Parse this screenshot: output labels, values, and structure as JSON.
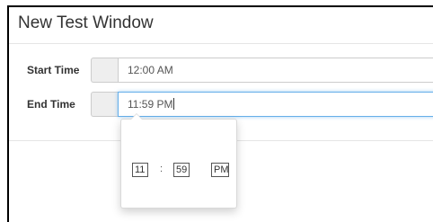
{
  "window": {
    "title": "New Test Window"
  },
  "form": {
    "start": {
      "label": "Start Time",
      "value": "12:00 AM"
    },
    "end": {
      "label": "End Time",
      "value": "11:59 PM"
    }
  },
  "picker": {
    "hour": "11",
    "separator": ":",
    "minute": "59",
    "meridian": "PM"
  },
  "colors": {
    "focus_border": "#66afe9",
    "addon_bg": "#eeeeee",
    "window_edge": "#000000"
  }
}
